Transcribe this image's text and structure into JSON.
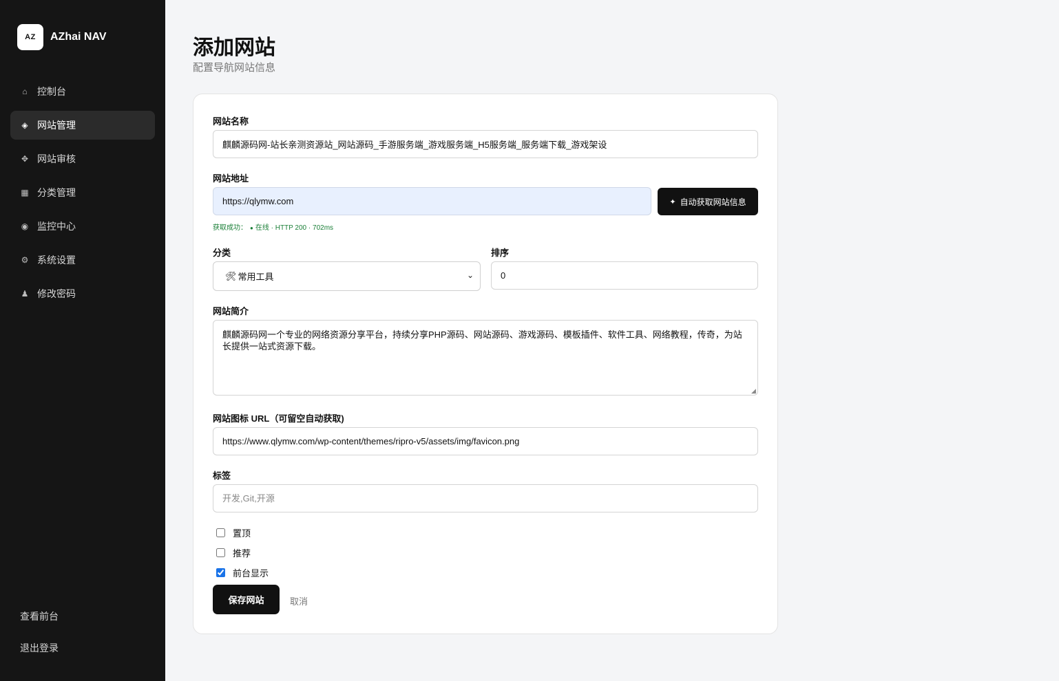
{
  "app": {
    "logo_text": "AZ",
    "name": "AZhai NAV"
  },
  "sidebar": {
    "items": [
      {
        "label": "控制台",
        "icon": "home-icon",
        "glyph": "⌂",
        "active": false
      },
      {
        "label": "网站管理",
        "icon": "diamond-icon",
        "glyph": "◈",
        "active": true
      },
      {
        "label": "网站审核",
        "icon": "review-icon",
        "glyph": "✥",
        "active": false
      },
      {
        "label": "分类管理",
        "icon": "grid-icon",
        "glyph": "▦",
        "active": false
      },
      {
        "label": "监控中心",
        "icon": "monitor-icon",
        "glyph": "◉",
        "active": false
      },
      {
        "label": "系统设置",
        "icon": "gear-icon",
        "glyph": "⚙",
        "active": false
      },
      {
        "label": "修改密码",
        "icon": "user-icon",
        "glyph": "♟",
        "active": false
      }
    ],
    "bottom": {
      "view_front": "查看前台",
      "logout": "退出登录"
    }
  },
  "page": {
    "title": "添加网站",
    "subtitle": "配置导航网站信息"
  },
  "form": {
    "name": {
      "label": "网站名称",
      "value": "麒麟源码网-站长亲测资源站_网站源码_手游服务端_游戏服务端_H5服务端_服务端下载_游戏架设"
    },
    "url": {
      "label": "网站地址",
      "value": "https://qlymw.com",
      "fetch_button": "自动获取网站信息",
      "status_prefix": "获取成功：",
      "status_dot": "●",
      "status_text": "在线 · HTTP 200 · 702ms",
      "status_color": "#1a7f37"
    },
    "category": {
      "label": "分类",
      "icon": "tools-icon",
      "selected": "常用工具"
    },
    "sort": {
      "label": "排序",
      "value": "0"
    },
    "description": {
      "label": "网站简介",
      "value": "麒麟源码网一个专业的网络资源分享平台，持续分享PHP源码、网站源码、游戏源码、模板插件、软件工具、网络教程，传奇，为站长提供一站式资源下载。"
    },
    "icon_url": {
      "label": "网站图标 URL（可留空自动获取)",
      "value": "https://www.qlymw.com/wp-content/themes/ripro-v5/assets/img/favicon.png"
    },
    "tags": {
      "label": "标签",
      "placeholder": "开发,Git,开源",
      "value": ""
    },
    "checkboxes": [
      {
        "label": "置顶",
        "checked": false
      },
      {
        "label": "推荐",
        "checked": false
      },
      {
        "label": "前台显示",
        "checked": true
      }
    ],
    "save_button": "保存网站",
    "cancel_link": "取消"
  }
}
